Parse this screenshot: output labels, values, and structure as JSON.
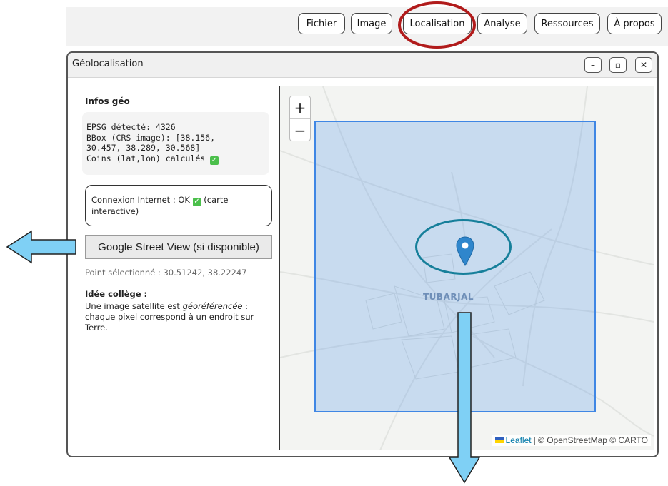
{
  "menu": {
    "items": [
      {
        "label": "Fichier"
      },
      {
        "label": "Image"
      },
      {
        "label": "Localisation"
      },
      {
        "label": "Analyse"
      },
      {
        "label": "Ressources"
      },
      {
        "label": "À propos"
      }
    ],
    "highlighted_item": "Localisation"
  },
  "window": {
    "title": "Géolocalisation",
    "minimize_label": "–",
    "maximize_label": "▫",
    "close_label": "✕"
  },
  "infos": {
    "title": "Infos géo",
    "epsg_line": "EPSG détecté: 4326",
    "bbox_line1": "BBox (CRS image): [38.156,",
    "bbox_line2": "30.457, 38.289, 30.568]",
    "corners_line": "Coins (lat,lon) calculés",
    "check_glyph": "✓"
  },
  "connection": {
    "text_before": "Connexion Internet : OK",
    "text_after": "(carte interactive)"
  },
  "street_view_button": "Google Street View (si disponible)",
  "selected_point": "Point sélectionné : 30.51242, 38.22247",
  "idea": {
    "title": "Idée collège :",
    "text_before": "Une image satellite est ",
    "text_emphasis": "géoréférencée",
    "text_after": " : chaque pixel correspond à un endroit sur Terre."
  },
  "map": {
    "zoom_in": "+",
    "zoom_out": "−",
    "place_label": "TUBARJAL",
    "attribution_link": "Leaflet",
    "attribution_text": "| © OpenStreetMap © CARTO",
    "marker_icon": "map-marker-icon",
    "bbox_color": "#3f86e4"
  },
  "annotations": {
    "menu_ring_color": "#b11b1b",
    "marker_ring_color": "#167f9a",
    "arrow_color": "#7fd0f5"
  }
}
